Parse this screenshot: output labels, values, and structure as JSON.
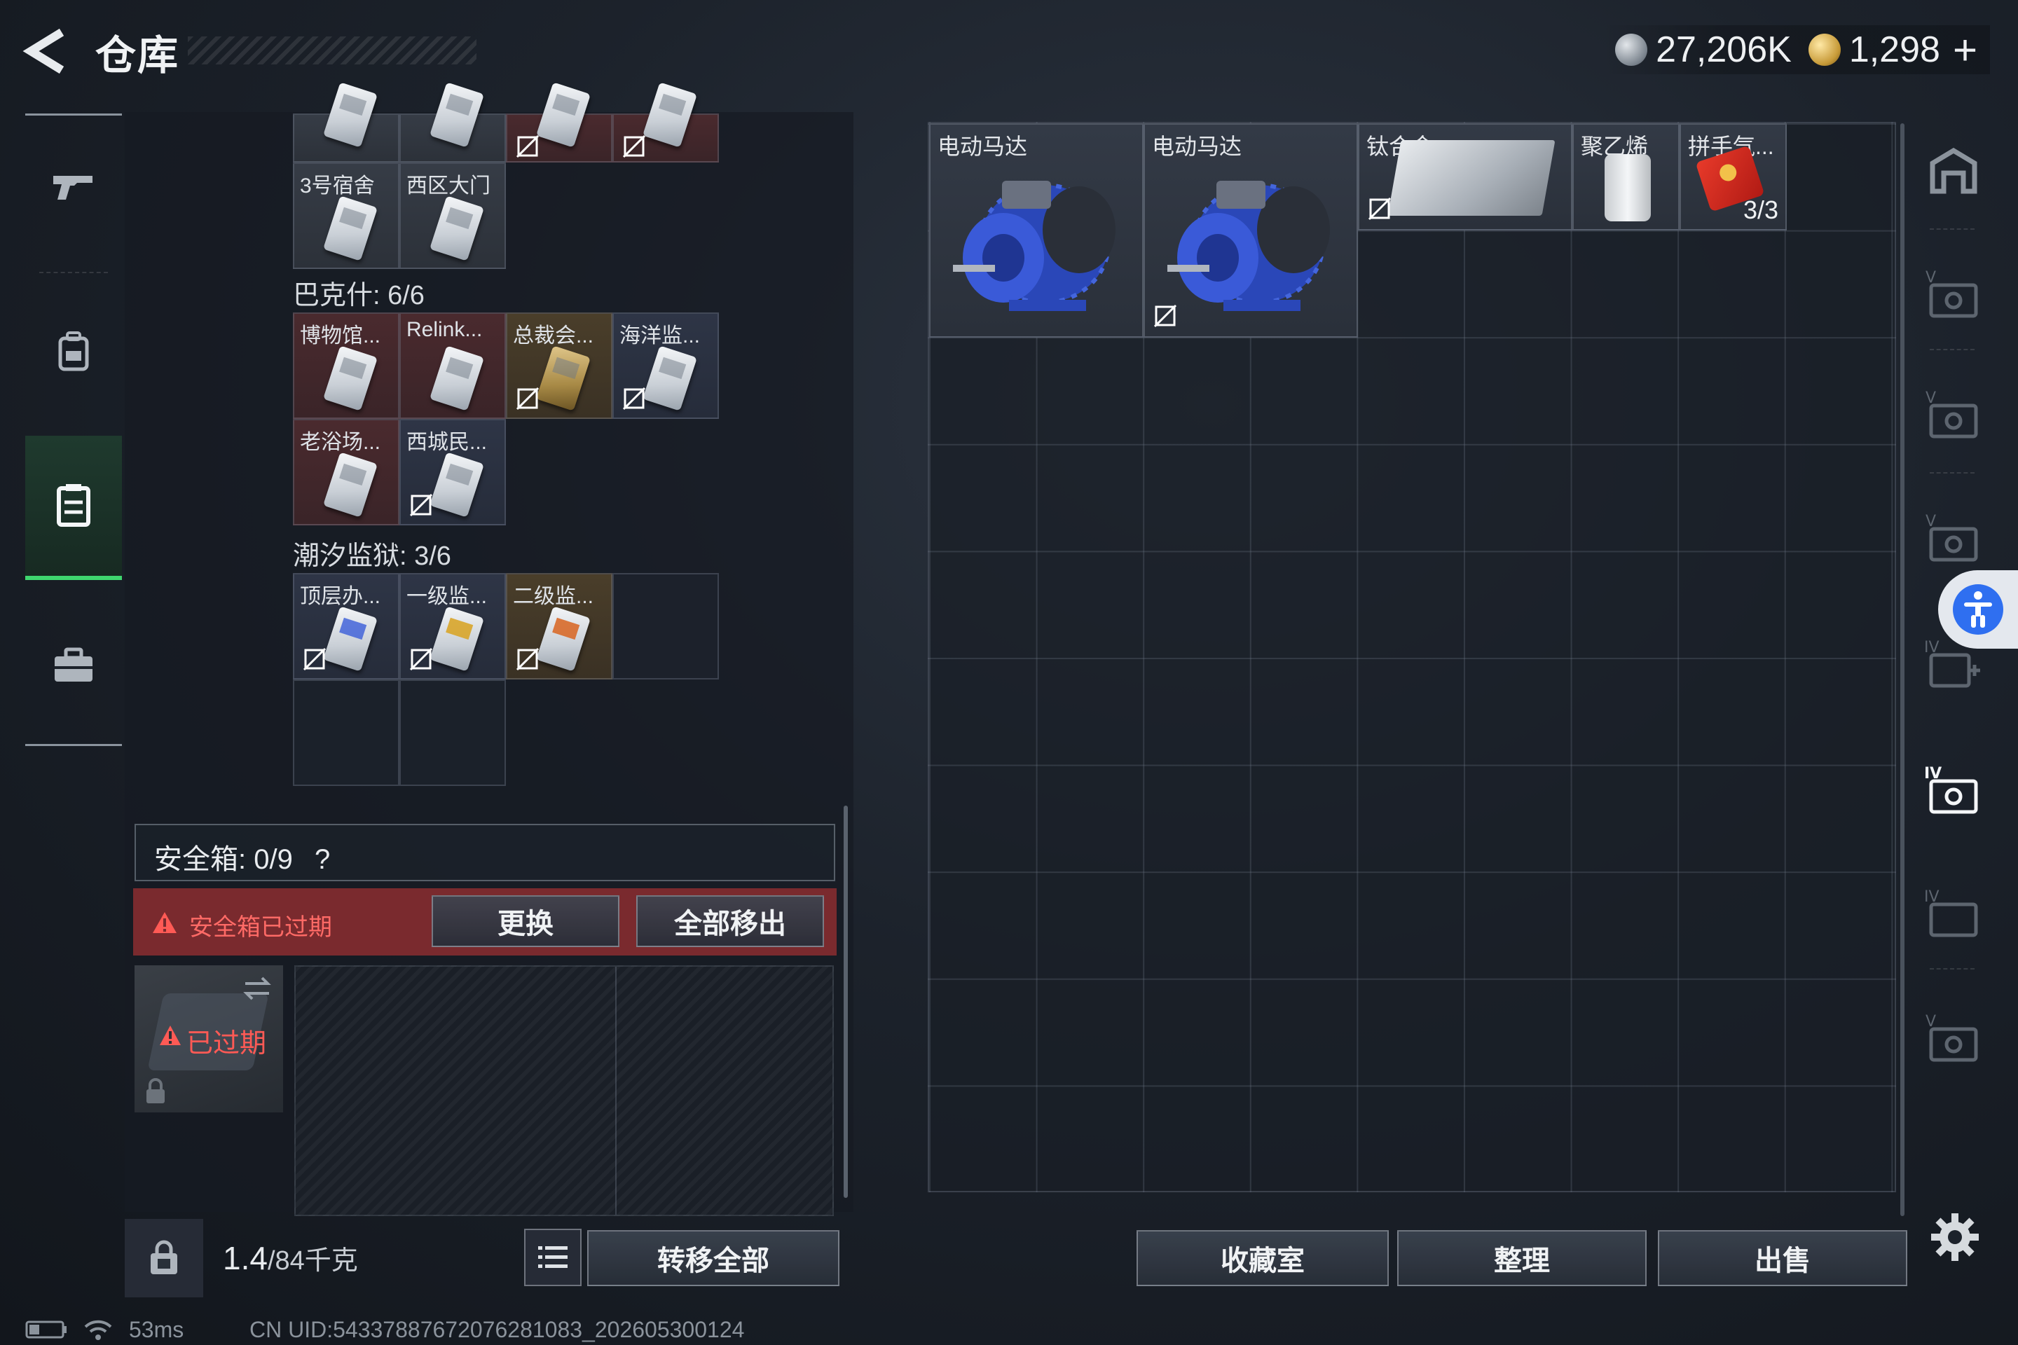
{
  "header": {
    "title": "仓库",
    "currency": {
      "silver_amount": "27,206K",
      "gold_amount": "1,298",
      "plus": "+"
    }
  },
  "left_nav": {
    "items": [
      {
        "icon": "gun-icon",
        "label": ""
      },
      {
        "icon": "backpack-icon",
        "label": ""
      },
      {
        "icon": "warehouse-icon",
        "label": "",
        "active": true
      },
      {
        "icon": "toolbox-icon",
        "label": ""
      }
    ]
  },
  "key_groups": {
    "top_row": [
      "",
      "",
      "",
      ""
    ],
    "row2": [
      "3号宿舍",
      "西区大门"
    ],
    "bakshi": {
      "title": "巴克什: 6/6",
      "items": [
        "博物馆...",
        "Relink...",
        "总裁会...",
        "海洋监...",
        "老浴场...",
        "西城民..."
      ]
    },
    "tide_prison": {
      "title": "潮汐监狱: 3/6",
      "items": [
        "顶层办...",
        "一级监...",
        "二级监..."
      ]
    }
  },
  "safe_box": {
    "title": "安全箱: 0/9",
    "help": "?",
    "warning": "安全箱已过期",
    "replace_label": "更换",
    "move_all_label": "全部移出",
    "expired_label": "已过期"
  },
  "bottom_left": {
    "weight_current": "1.4",
    "weight_max": "/84千克",
    "transfer_all_label": "转移全部"
  },
  "status": {
    "ping": "53ms",
    "uid": "CN UID:54337887672076281083_202605300124"
  },
  "storage_items": [
    {
      "name": "电动马达",
      "icon": "electric-motor"
    },
    {
      "name": "电动马达",
      "icon": "electric-motor"
    },
    {
      "name": "钛合金",
      "icon": "titanium-plate"
    },
    {
      "name": "聚乙烯",
      "icon": "polyethylene-roll"
    },
    {
      "name": "拼手气...",
      "icon": "red-envelope",
      "count": "3/3"
    }
  ],
  "bottom_right": {
    "collection_label": "收藏室",
    "organize_label": "整理",
    "sell_label": "出售"
  },
  "colors": {
    "accent_green": "#3fd66f",
    "warning_red": "#ff6a66",
    "warning_bg": "#7a2a2e"
  }
}
